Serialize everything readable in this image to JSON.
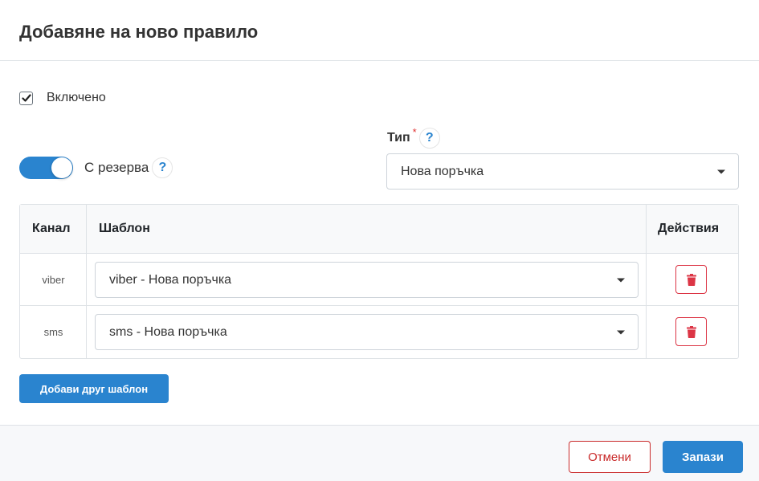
{
  "dialog": {
    "title": "Добавяне на ново правило"
  },
  "enabled": {
    "label": "Включено",
    "checked": true
  },
  "backup": {
    "label": "С резерва",
    "on": true,
    "help": "?"
  },
  "type": {
    "label": "Тип",
    "required_mark": "*",
    "help": "?",
    "value": "Нова поръчка"
  },
  "table": {
    "headers": [
      "Канал",
      "Шаблон",
      "Действия"
    ],
    "rows": [
      {
        "channel": "viber",
        "template": "viber - Нова поръчка"
      },
      {
        "channel": "sms",
        "template": "sms - Нова поръчка"
      }
    ]
  },
  "add_template_label": "Добави друг шаблон",
  "footer": {
    "cancel_label": "Отмени",
    "save_label": "Запази"
  },
  "colors": {
    "primary": "#2a84cf",
    "danger": "#dc3545"
  },
  "icons": {
    "checkbox": "check-icon",
    "help": "question-icon",
    "caret": "chevron-down-icon",
    "delete": "trash-icon"
  }
}
